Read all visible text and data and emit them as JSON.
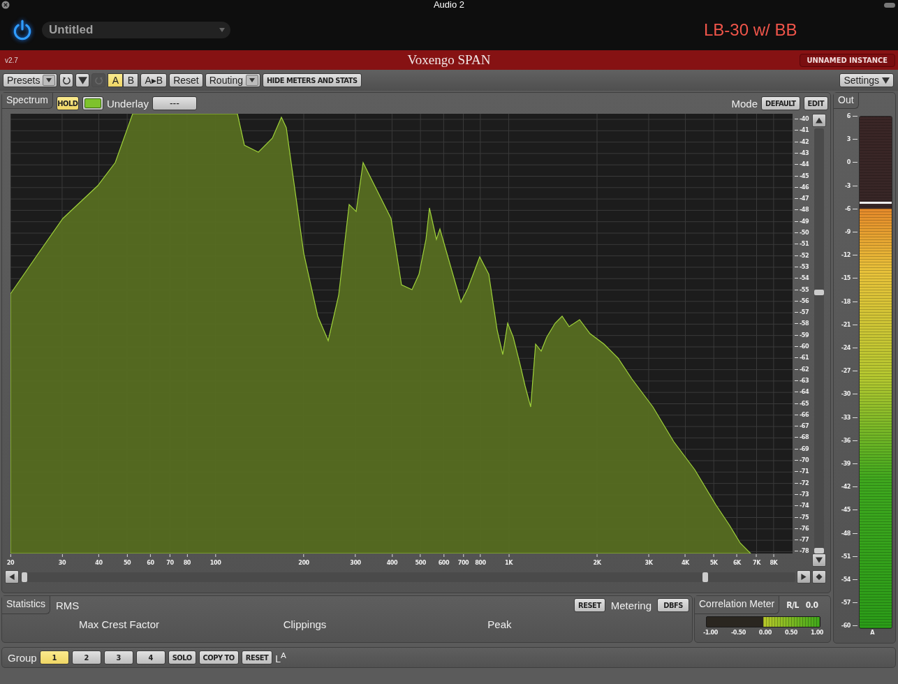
{
  "host": {
    "title": "Audio 2",
    "preset": "Untitled",
    "track_name": "LB-30 w/ BB"
  },
  "plugin_bar": {
    "version": "v2.7",
    "name": "Voxengo SPAN",
    "instance": "UNNAMED INSTANCE"
  },
  "toolbar": {
    "presets": "Presets",
    "redo_disabled": true,
    "ab": [
      {
        "label": "A",
        "selected": true
      },
      {
        "label": "B",
        "selected": false
      }
    ],
    "copy_ab": "A▸B",
    "reset": "Reset",
    "routing": "Routing",
    "hide": "HIDE METERS AND STATS",
    "settings": "Settings"
  },
  "spectrum": {
    "tab": "Spectrum",
    "hold": {
      "label": "HOLD",
      "on": true
    },
    "underlay_label": "Underlay",
    "underlay_value": "---",
    "mode_label": "Mode",
    "mode_buttons": [
      "DEFAULT",
      "EDIT"
    ],
    "y_ticks": [
      "-40",
      "-41",
      "-42",
      "-43",
      "-44",
      "-45",
      "-46",
      "-47",
      "-48",
      "-49",
      "-50",
      "-51",
      "-52",
      "-53",
      "-54",
      "-55",
      "-56",
      "-57",
      "-58",
      "-59",
      "-60",
      "-61",
      "-62",
      "-63",
      "-64",
      "-65",
      "-66",
      "-67",
      "-68",
      "-69",
      "-70",
      "-71",
      "-72",
      "-73",
      "-74",
      "-75",
      "-76",
      "-77",
      "-78"
    ],
    "x_ticks": [
      "20",
      "30",
      "40",
      "50",
      "60",
      "70",
      "80",
      "100",
      "200",
      "300",
      "400",
      "500",
      "600",
      "700",
      "800",
      "1K",
      "2K",
      "3K",
      "4K",
      "5K",
      "6K",
      "7K",
      "8K"
    ]
  },
  "out": {
    "tab": "Out",
    "ticks": [
      "6",
      "3",
      "0",
      "-3",
      "-6",
      "-9",
      "-12",
      "-15",
      "-18",
      "-21",
      "-24",
      "-27",
      "-30",
      "-33",
      "-36",
      "-39",
      "-42",
      "-45",
      "-48",
      "-51",
      "-54",
      "-57",
      "-60"
    ],
    "level": 0.82,
    "channel": "A"
  },
  "statistics": {
    "tab": "Statistics",
    "type": "RMS",
    "columns": [
      "Max Crest Factor",
      "Clippings",
      "Peak"
    ],
    "reset": "RESET",
    "metering_label": "Metering",
    "metering_value": "DBFS"
  },
  "correlation": {
    "tab": "Correlation Meter",
    "channel": "R/L",
    "value": "0.0",
    "level": 0.5,
    "ticks": [
      "-1.00",
      "-0.50",
      "0.00",
      "0.50",
      "1.00"
    ]
  },
  "group": {
    "label": "Group",
    "buttons": [
      {
        "label": "1",
        "selected": true
      },
      {
        "label": "2",
        "selected": false
      },
      {
        "label": "3",
        "selected": false
      },
      {
        "label": "4",
        "selected": false
      }
    ],
    "solo": "SOLO",
    "copy_to": "COPY TO",
    "reset": "RESET",
    "indicator": "L$^{A}$"
  }
}
